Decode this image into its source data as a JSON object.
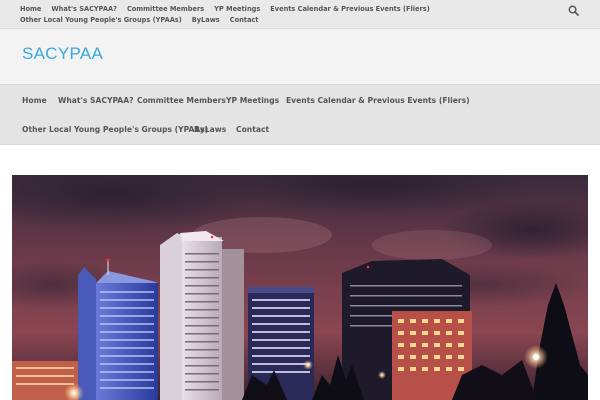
{
  "top_nav": {
    "items": [
      "Home",
      "What's SACYPAA?",
      "Committee Members",
      "YP Meetings",
      "Events Calendar & Previous Events (Fliers)",
      "Other Local Young People's Groups (YPAAs)",
      "ByLaws",
      "Contact"
    ]
  },
  "site": {
    "title": "SACYPAA"
  },
  "main_nav": {
    "items": [
      "Home",
      "What's SACYPAA?",
      "Committee Members",
      "YP Meetings",
      "Events Calendar & Previous Events (Fliers)",
      "Other Local Young People's Groups (YPAAs)",
      "ByLaws",
      "Contact"
    ]
  },
  "icons": {
    "search": "search-icon"
  },
  "colors": {
    "site_title": "#3aa8e0",
    "nav_text": "#555555",
    "topbar_bg": "#e9e9e9",
    "nav_bg": "#e4e4e4"
  }
}
